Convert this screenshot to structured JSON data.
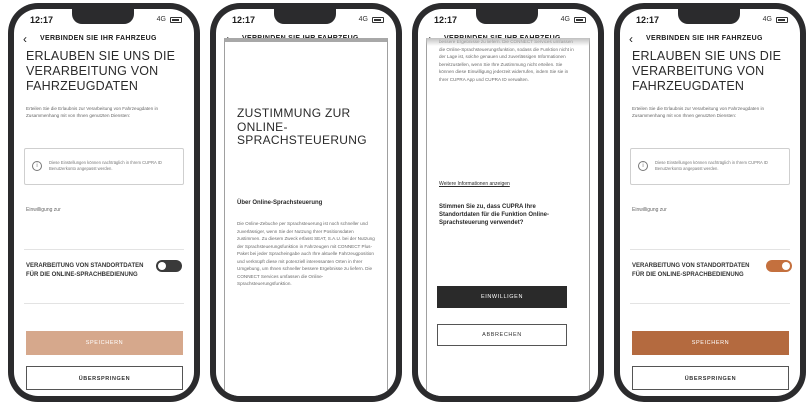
{
  "status": {
    "time": "12:17",
    "network": "4G"
  },
  "header": {
    "title": "VERBINDEN SIE IHR FAHRZEUG"
  },
  "colors": {
    "accent_pale": "#d6a88c",
    "accent_active": "#b46a3f",
    "toggle_off": "#3a3a3a",
    "toggle_on": "#c4703e",
    "dark_button": "#2a2a2a"
  },
  "permission_screen": {
    "title": "ERLAUBEN SIE UNS DIE VERARBEITUNG VON FAHRZEUGDATEN",
    "intro": "Erteilen Sie die Erlaubnis zur Verarbeitung von Fahrzeugdaten in Zusammenhang mit von Ihnen genutzten Diensten:",
    "info_icon": "info-circle-icon",
    "info_text": "Diese Einstellungen können nachträglich in Ihrem CUPRA ID Benutzerkonto angepasst werden.",
    "consent_label": "Einwilligung zur",
    "setting_label": "VERARBEITUNG VON STANDORTDATEN FÜR DIE ONLINE-SPRACHBEDIENUNG",
    "save_label": "SPEICHERN",
    "skip_label": "ÜBERSPRINGEN"
  },
  "consent_screen": {
    "title": "ZUSTIMMUNG ZUR ONLINE-SPRACHSTEUERUNG",
    "section_heading": "Über Online-Sprachsteuerung",
    "body": "Die Online-Zebuche per Sprachsteuerung ist noch schneller und zuverlässiger, wenn Sie der Nutzung Ihrer Positionsdaten zustimmen. Zu diesem Zweck erfasst SEAT, S.A.U. bei der Nutzung der Sprachsteuerungsfunktion in Fahrzeugen mit CONNECT Plus-Paket bei jeder Spracheingabe auch Ihre aktuelle Fahrzeugposition und verknüpft diese mit potenziell interessanten Orten in Ihrer Umgebung, um Ihnen schneller bessere Ergebnisse zu liefern. Die CONNECT Services umfassen die Online-Sprachsteuerungsfunktion.",
    "body_continued": "bessere Ergebnisse zu liefern. Die CONNECT Services umfassen die Online-Sprachsteuerungsfunktion, sodass die Funktion nicht in der Lage ist, solche genauen und zuverlässigen Informationen bereitzustellen, wenn Sie Ihre Zustimmung nicht erteilen. Sie können diese Einwilligung jederzeit widerrufen, indem Sie sie in Ihrer CUPRA App und CUPRA ID verwalten.",
    "more_link": "Weitere Informationen anzeigen",
    "question": "Stimmen Sie zu, dass CUPRA Ihre Standortdaten für die Funktion Online-Sprachsteuerung verwendet?",
    "agree_label": "EINWILLIGEN",
    "cancel_label": "ABBRECHEN"
  }
}
